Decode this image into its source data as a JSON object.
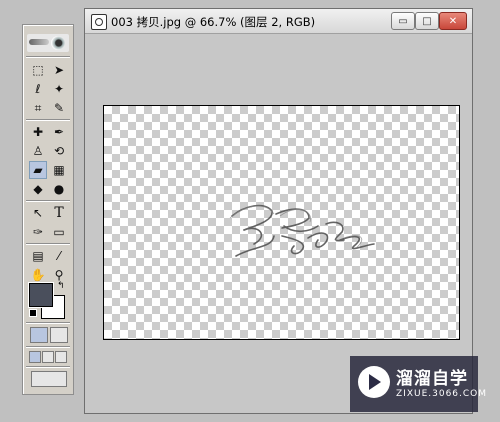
{
  "document": {
    "title": "003 拷贝.jpg @ 66.7% (图层 2, RGB)",
    "window_buttons": {
      "minimize": "▭",
      "maximize": "□",
      "close": "✕"
    }
  },
  "toolbox": {
    "tools": [
      {
        "name": "marquee-tool",
        "glyph": "⬚"
      },
      {
        "name": "move-tool",
        "glyph": "➤"
      },
      {
        "name": "lasso-tool",
        "glyph": "ℓ"
      },
      {
        "name": "magic-wand-tool",
        "glyph": "✦"
      },
      {
        "name": "crop-tool",
        "glyph": "⌗"
      },
      {
        "name": "slice-tool",
        "glyph": "✎"
      },
      {
        "name": "healing-brush-tool",
        "glyph": "✚"
      },
      {
        "name": "brush-tool",
        "glyph": "✒"
      },
      {
        "name": "stamp-tool",
        "glyph": "♙"
      },
      {
        "name": "history-brush-tool",
        "glyph": "⟲"
      },
      {
        "name": "eraser-tool",
        "glyph": "▰"
      },
      {
        "name": "gradient-tool",
        "glyph": "▦"
      },
      {
        "name": "blur-tool",
        "glyph": "◆"
      },
      {
        "name": "dodge-tool",
        "glyph": "●"
      },
      {
        "name": "path-selection-tool",
        "glyph": "↖"
      },
      {
        "name": "type-tool",
        "glyph": "T"
      },
      {
        "name": "pen-tool",
        "glyph": "✑"
      },
      {
        "name": "shape-tool",
        "glyph": "▭"
      },
      {
        "name": "notes-tool",
        "glyph": "▤"
      },
      {
        "name": "eyedropper-tool",
        "glyph": "⁄"
      },
      {
        "name": "hand-tool",
        "glyph": "✋"
      },
      {
        "name": "zoom-tool",
        "glyph": "⚲"
      }
    ],
    "foreground_color": "#4a4f5c",
    "background_color": "#ffffff"
  },
  "canvas": {
    "signature_text": "马露之"
  },
  "watermark": {
    "brand": "溜溜自学",
    "url": "ZIXUE.3066.COM"
  }
}
